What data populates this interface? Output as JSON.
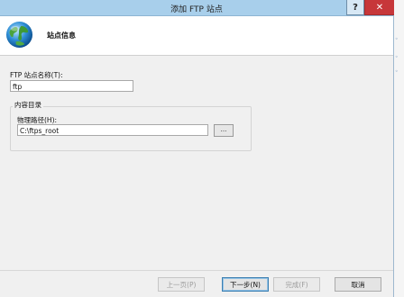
{
  "window": {
    "title": "添加 FTP 站点",
    "help_label": "?",
    "close_label": "✕"
  },
  "header": {
    "title": "站点信息",
    "icon": "globe-icon"
  },
  "form": {
    "site_name_label": "FTP 站点名称(T):",
    "site_name_value": "ftp",
    "content_dir_label": "内容目录",
    "physical_path_label": "物理路径(H):",
    "physical_path_value": "C:\\ftps_root",
    "browse_label": "..."
  },
  "buttons": {
    "prev": "上一页(P)",
    "next": "下一步(N)",
    "finish": "完成(F)",
    "cancel": "取消"
  },
  "colors": {
    "titlebar": "#a8cfeb",
    "close": "#c7373a",
    "default_button_border": "#3c7fb1"
  }
}
